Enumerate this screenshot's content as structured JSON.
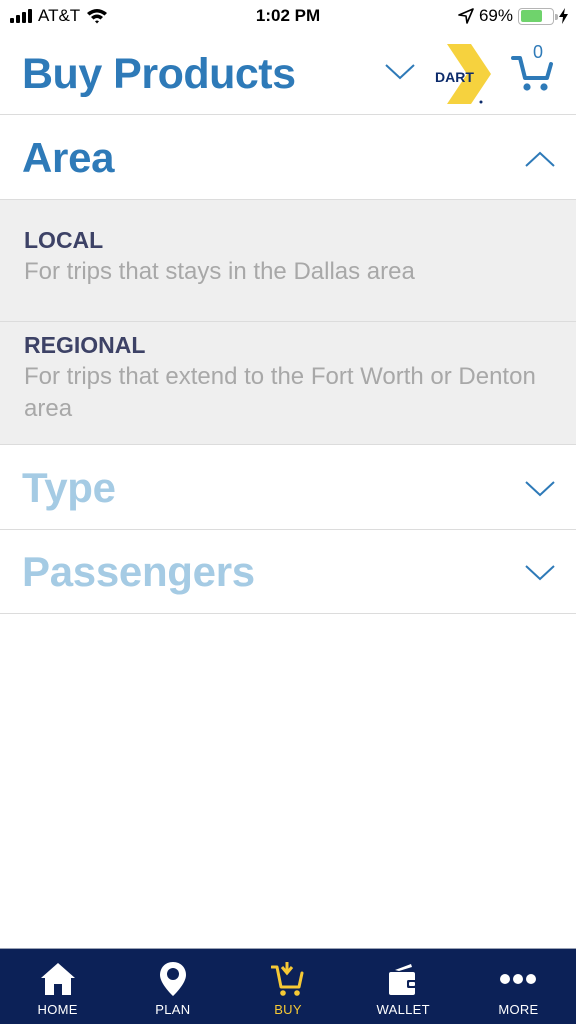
{
  "status_bar": {
    "carrier": "AT&T",
    "time": "1:02 PM",
    "battery_percent": "69%",
    "battery_level": 0.69,
    "icons": [
      "signal-icon",
      "wifi-icon",
      "location-arrow-icon",
      "battery-icon",
      "charging-bolt-icon"
    ]
  },
  "header": {
    "title": "Buy Products",
    "logo_text": "DART",
    "cart_count": "0",
    "colors": {
      "title": "#2e7ab8",
      "logo_yellow": "#f6d23e",
      "logo_navy": "#0c2b6b"
    }
  },
  "sections": [
    {
      "title": "Area",
      "expanded": true,
      "options": [
        {
          "name": "LOCAL",
          "description": "For trips that stays in the Dallas area"
        },
        {
          "name": "REGIONAL",
          "description": "For trips that extend to the Fort Worth or Denton area"
        }
      ]
    },
    {
      "title": "Type",
      "expanded": false
    },
    {
      "title": "Passengers",
      "expanded": false
    }
  ],
  "tab_bar": {
    "active": "BUY",
    "tabs": [
      {
        "label": "HOME",
        "icon": "home-icon"
      },
      {
        "label": "PLAN",
        "icon": "map-pin-icon"
      },
      {
        "label": "BUY",
        "icon": "cart-download-icon"
      },
      {
        "label": "WALLET",
        "icon": "wallet-icon"
      },
      {
        "label": "MORE",
        "icon": "more-dots-icon"
      }
    ],
    "colors": {
      "background": "#0c2157",
      "active": "#f6c935",
      "inactive": "#ffffff"
    }
  }
}
